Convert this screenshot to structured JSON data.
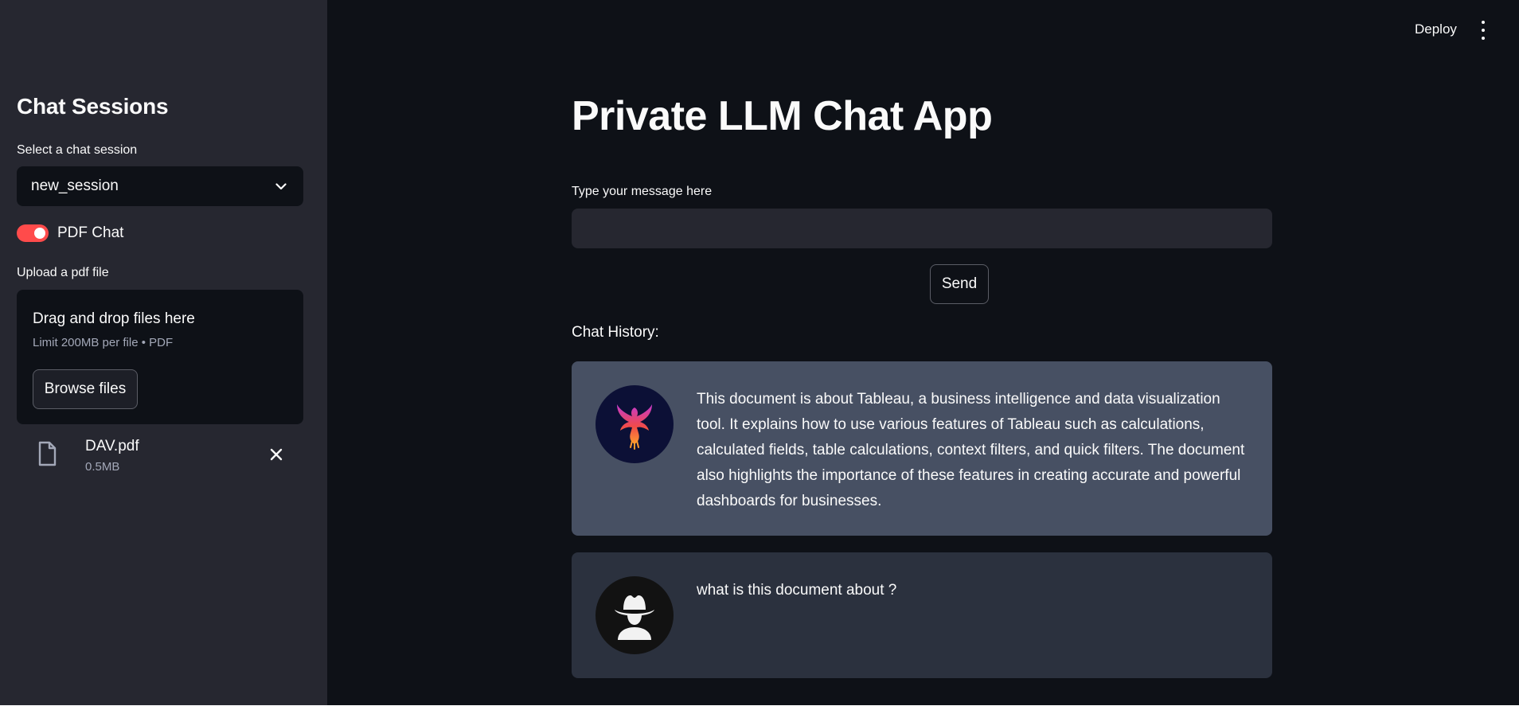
{
  "sidebar": {
    "title": "Chat Sessions",
    "session_select_label": "Select a chat session",
    "session_selected": "new_session",
    "pdf_toggle_label": "PDF Chat",
    "pdf_toggle_on": true,
    "upload_label": "Upload a pdf file",
    "dropzone": {
      "title": "Drag and drop files here",
      "limit": "Limit 200MB per file • PDF",
      "browse_label": "Browse files"
    },
    "uploaded_file": {
      "name": "DAV.pdf",
      "size": "0.5MB"
    }
  },
  "header": {
    "deploy_label": "Deploy"
  },
  "main": {
    "title": "Private LLM Chat App",
    "input_label": "Type your message here",
    "input_value": "",
    "send_label": "Send",
    "history_label": "Chat History:",
    "messages": [
      {
        "role": "assistant",
        "avatar_icon": "phoenix-icon",
        "text": "This document is about Tableau, a business intelligence and data visualization tool. It explains how to use various features of Tableau such as calculations, calculated fields, table calculations, context filters, and quick filters. The document also highlights the importance of these features in creating accurate and powerful dashboards for businesses."
      },
      {
        "role": "user",
        "avatar_icon": "cowboy-user-icon",
        "text": "what is this document about ?"
      }
    ]
  },
  "colors": {
    "main_bg": "#0e1117",
    "sidebar_bg": "#262730",
    "accent": "#ff4b4b",
    "assistant_card": "#475063",
    "user_card": "#2b313e"
  }
}
